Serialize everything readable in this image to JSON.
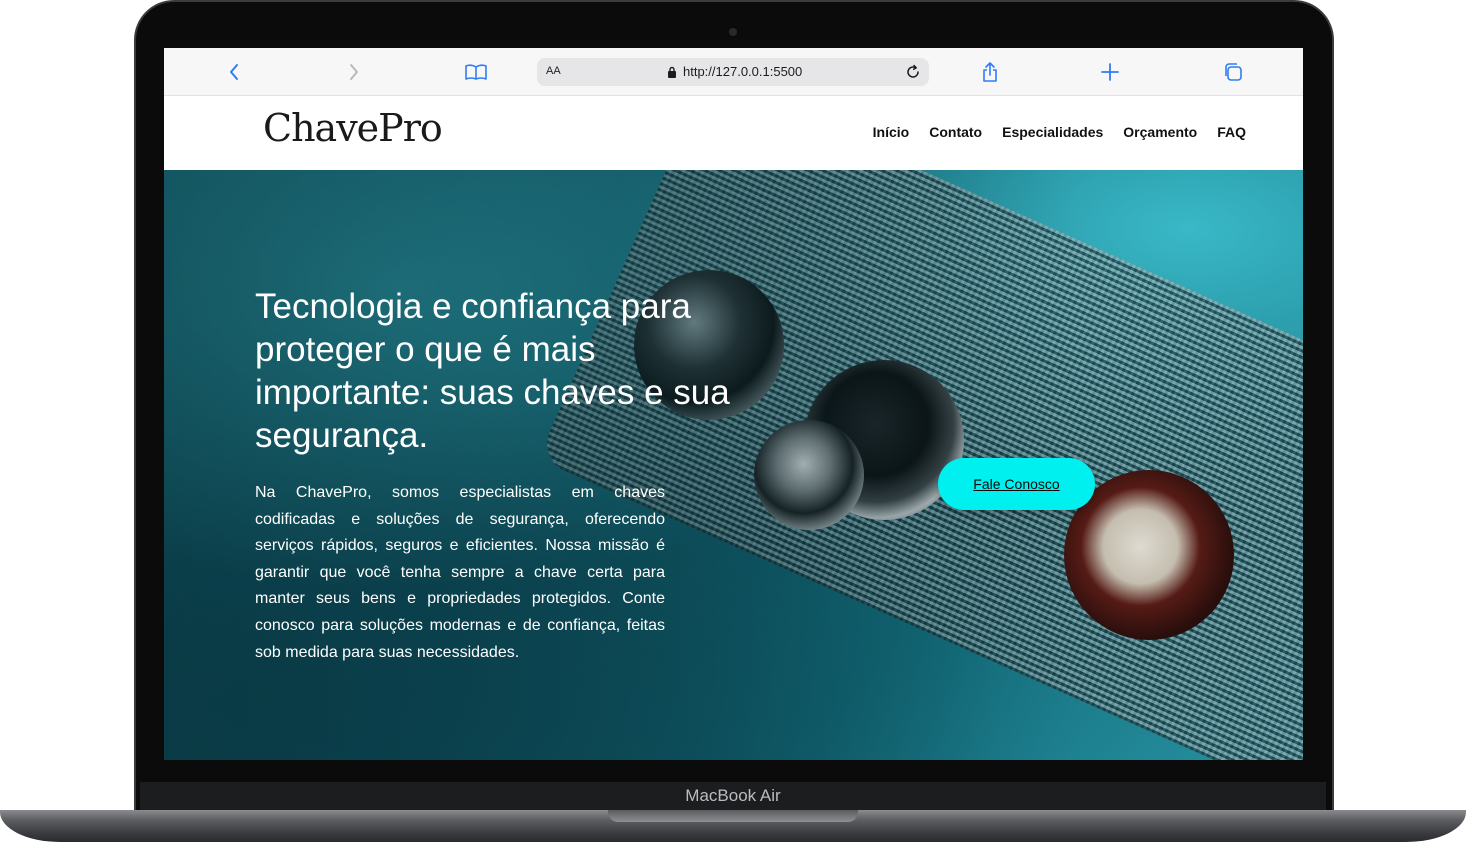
{
  "device": {
    "model_label": "MacBook Air"
  },
  "browser": {
    "text_size_label": "AA",
    "url": "http://127.0.0.1:5500",
    "icons": {
      "back": "chevron-left-icon",
      "forward": "chevron-right-icon",
      "bookmarks": "book-icon",
      "lock": "lock-icon",
      "reload": "reload-icon",
      "share": "share-icon",
      "new_tab": "plus-icon",
      "tabs": "tabs-icon"
    },
    "accent_color": "#2f7df6"
  },
  "site": {
    "logo": "ChavePro",
    "nav": [
      {
        "label": "Início"
      },
      {
        "label": "Contato"
      },
      {
        "label": "Especialidades"
      },
      {
        "label": "Orçamento"
      },
      {
        "label": "FAQ"
      }
    ]
  },
  "hero": {
    "title": "Tecnologia e confiança para proteger o que é mais importante: suas chaves e sua segurança.",
    "text": "Na ChavePro, somos especialistas em chaves codificadas e soluções de segurança, oferecendo serviços rápidos, seguros e eficientes. Nossa missão é garantir que você tenha sempre a chave certa para manter seus bens e propriedades protegidos. Conte conosco para soluções modernas e de confiança, feitas sob medida para suas necessidades.",
    "cta_label": "Fale Conosco",
    "cta_color": "#00f0f0"
  }
}
